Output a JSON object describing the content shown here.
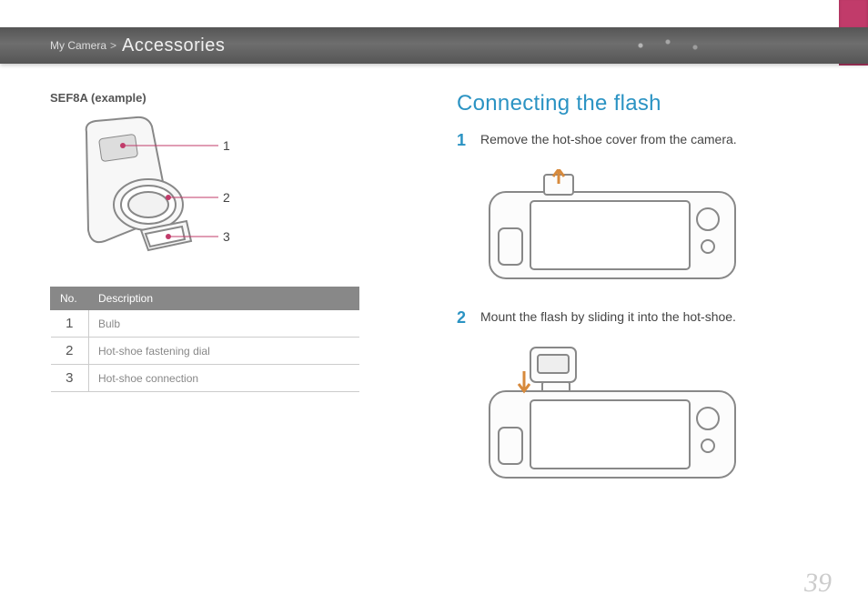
{
  "breadcrumb": {
    "parent": "My Camera",
    "separator": ">",
    "current": "Accessories"
  },
  "left": {
    "example_label": "SEF8A (example)",
    "callouts": [
      "1",
      "2",
      "3"
    ],
    "table": {
      "head_no": "No.",
      "head_desc": "Description",
      "rows": [
        {
          "no": "1",
          "desc": "Bulb"
        },
        {
          "no": "2",
          "desc": "Hot-shoe fastening dial"
        },
        {
          "no": "3",
          "desc": "Hot-shoe connection"
        }
      ]
    }
  },
  "right": {
    "title": "Connecting the flash",
    "steps": [
      {
        "num": "1",
        "text": "Remove the hot-shoe cover from the camera."
      },
      {
        "num": "2",
        "text": "Mount the flash by sliding it into the hot-shoe."
      }
    ]
  },
  "page_number": "39"
}
